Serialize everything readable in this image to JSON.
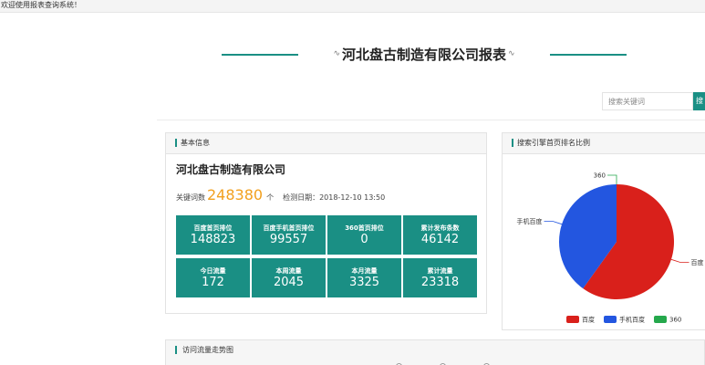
{
  "topbar": {
    "welcome": "欢迎使用报表查询系统！"
  },
  "header": {
    "title": "河北盘古制造有限公司报表",
    "wave_glyph": "∿"
  },
  "search": {
    "placeholder": "搜索关键词",
    "button_label": "搜"
  },
  "basic_panel": {
    "heading": "基本信息",
    "company": "河北盘古制造有限公司",
    "keyword_label": "关键词数",
    "keyword_count": "248380",
    "keyword_unit": "个",
    "check_date": "检测日期：2018-12-10 13:50",
    "stats": [
      {
        "label": "百度首页排位",
        "value": "148823"
      },
      {
        "label": "百度手机首页排位",
        "value": "99557"
      },
      {
        "label": "360首页排位",
        "value": "0"
      },
      {
        "label": "累计发布条数",
        "value": "46142"
      },
      {
        "label": "今日流量",
        "value": "172"
      },
      {
        "label": "本周流量",
        "value": "2045"
      },
      {
        "label": "本月流量",
        "value": "3325"
      },
      {
        "label": "累计流量",
        "value": "23318"
      }
    ]
  },
  "pie_panel": {
    "heading": "搜索引擎首页排名比例"
  },
  "chart_data": {
    "type": "pie",
    "title": "",
    "series": [
      {
        "name": "百度",
        "value": 148823,
        "color": "#d9201b"
      },
      {
        "name": "手机百度",
        "value": 99557,
        "color": "#2356e0"
      },
      {
        "name": "360",
        "value": 0,
        "color": "#25a84c"
      }
    ],
    "legend_position": "bottom"
  },
  "traffic_panel": {
    "heading": "访问流量走势图"
  }
}
